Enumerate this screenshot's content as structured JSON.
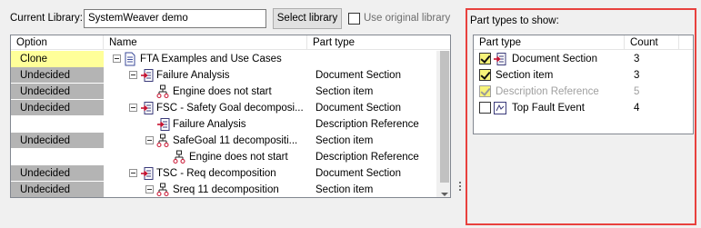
{
  "toolbar": {
    "current_library_label": "Current Library:",
    "library_value": "SystemWeaver demo",
    "select_library_label": "Select library",
    "use_original_label": "Use original library",
    "use_original_checked": false
  },
  "grid": {
    "columns": [
      "Option",
      "Name",
      "Part type"
    ],
    "rows": [
      {
        "option": "Clone",
        "option_style": "clone",
        "name": "FTA Examples and Use Cases",
        "part_type": "",
        "indent": 0,
        "icon": "document-icon",
        "expander": true
      },
      {
        "option": "Undecided",
        "option_style": "undecided",
        "name": "Failure Analysis",
        "part_type": "Document Section",
        "indent": 1,
        "icon": "document-section-icon",
        "expander": true
      },
      {
        "option": "Undecided",
        "option_style": "undecided",
        "name": "Engine does not start",
        "part_type": "Section item",
        "indent": 2,
        "icon": "fault-tree-icon",
        "expander": false
      },
      {
        "option": "Undecided",
        "option_style": "undecided",
        "name": "FSC - Safety Goal decomposi...",
        "part_type": "Document Section",
        "indent": 1,
        "icon": "document-section-icon",
        "expander": true
      },
      {
        "option": "",
        "option_style": "none",
        "name": "Failure Analysis",
        "part_type": "Description Reference",
        "indent": 2,
        "icon": "document-section-icon",
        "expander": false
      },
      {
        "option": "Undecided",
        "option_style": "undecided",
        "name": "SafeGoal 11 decompositi...",
        "part_type": "Section item",
        "indent": 2,
        "icon": "fault-tree-icon",
        "expander": true
      },
      {
        "option": "",
        "option_style": "none",
        "name": "Engine does not start",
        "part_type": "Description Reference",
        "indent": 3,
        "icon": "fault-tree-icon",
        "expander": false
      },
      {
        "option": "Undecided",
        "option_style": "undecided",
        "name": "TSC - Req decomposition",
        "part_type": "Document Section",
        "indent": 1,
        "icon": "document-section-icon",
        "expander": true
      },
      {
        "option": "Undecided",
        "option_style": "undecided",
        "name": "Sreq 11 decomposition",
        "part_type": "Section item",
        "indent": 2,
        "icon": "fault-tree-icon",
        "expander": true
      }
    ]
  },
  "part_types_panel": {
    "title": "Part types to show:",
    "columns": [
      "Part type",
      "Count"
    ],
    "rows": [
      {
        "name": "Document Section",
        "count": "3",
        "checked": true,
        "disabled": false,
        "icon": "document-section-icon"
      },
      {
        "name": "Section item",
        "count": "3",
        "checked": true,
        "disabled": false,
        "icon": ""
      },
      {
        "name": "Description Reference",
        "count": "5",
        "checked": true,
        "disabled": true,
        "icon": ""
      },
      {
        "name": "Top Fault Event",
        "count": "4",
        "checked": false,
        "disabled": false,
        "icon": "top-fault-event-icon"
      }
    ]
  },
  "colors": {
    "highlight_border": "#e8413e",
    "clone_bg": "#ffff99",
    "undecided_bg": "#b4b4b4",
    "checkbox_bg": "#f7f37a"
  }
}
